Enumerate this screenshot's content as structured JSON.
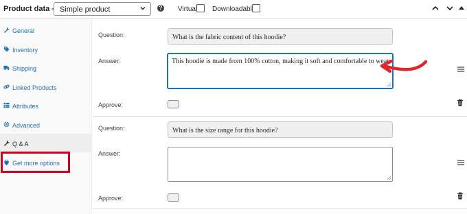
{
  "header": {
    "title": "Product data —",
    "product_type": "Simple product",
    "help_glyph": "?",
    "virtual_label": "Virtual:",
    "downloadable_label": "Downloadable:"
  },
  "sidebar": {
    "items": [
      {
        "label": "General",
        "icon": "wrench-icon"
      },
      {
        "label": "Inventory",
        "icon": "tag-icon"
      },
      {
        "label": "Shipping",
        "icon": "truck-icon"
      },
      {
        "label": "Linked Products",
        "icon": "link-icon"
      },
      {
        "label": "Attributes",
        "icon": "table-icon"
      },
      {
        "label": "Advanced",
        "icon": "gear-icon"
      },
      {
        "label": "Q & A",
        "icon": "wrench-icon"
      },
      {
        "label": "Get more options",
        "icon": "plugin-icon"
      }
    ],
    "active_index": 6
  },
  "qa": [
    {
      "question_label": "Question:",
      "question": "What is the fabric content of this hoodie?",
      "answer_label": "Answer:",
      "answer": "This hoodie is made from 100% cotton, making it soft and comfortable to wear.",
      "approve_label": "Approve:"
    },
    {
      "question_label": "Question:",
      "question": "What is the size range for this hoodie?",
      "answer_label": "Answer:",
      "answer": "",
      "approve_label": "Approve:"
    }
  ],
  "colors": {
    "accent": "#2271b1",
    "highlight": "#d0021b",
    "annotation_arrow": "#e0262a"
  }
}
